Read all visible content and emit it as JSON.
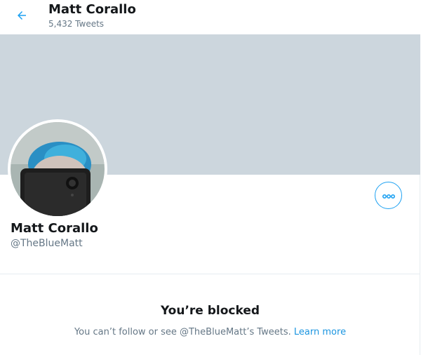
{
  "header": {
    "title": "Matt Corallo",
    "tweet_count": "5,432 Tweets",
    "back_icon": "arrow-left-icon"
  },
  "colors": {
    "accent": "#1da1f2",
    "banner": "#ccd6dd",
    "secondary_text": "#657786",
    "primary_text": "#14171a",
    "link": "#1b95e0"
  },
  "profile": {
    "display_name": "Matt Corallo",
    "handle": "@TheBlueMatt",
    "more_icon": "more-options-icon"
  },
  "blocked": {
    "title": "You’re blocked",
    "message_prefix": "You can’t follow or see @TheBlueMatt’s Tweets.",
    "learn_more": "Learn more"
  }
}
